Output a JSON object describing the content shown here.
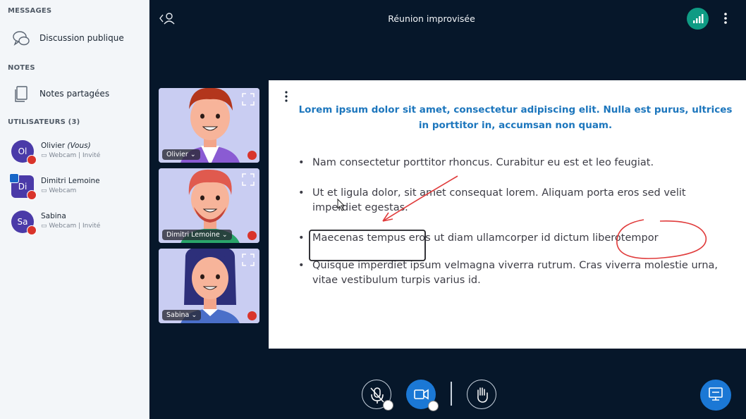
{
  "sidebar": {
    "messages_title": "MESSAGES",
    "public_chat": "Discussion publique",
    "notes_title": "NOTES",
    "shared_notes": "Notes partagées",
    "users_title": "UTILISATEURS (3)",
    "users": [
      {
        "initials": "Ol",
        "name": "Olivier",
        "you": "(Vous)",
        "sub": "Webcam | Invité"
      },
      {
        "initials": "Di",
        "name": "Dimitri Lemoine",
        "you": "",
        "sub": "Webcam"
      },
      {
        "initials": "Sa",
        "name": "Sabina",
        "you": "",
        "sub": "Webcam | Invité"
      }
    ]
  },
  "header": {
    "title": "Réunion improvisée"
  },
  "videos": [
    {
      "name": "Olivier"
    },
    {
      "name": "Dimitri Lemoine"
    },
    {
      "name": "Sabina"
    }
  ],
  "presentation": {
    "title": "Lorem ipsum dolor sit amet, consectetur adipiscing elit. Nulla est purus, ultrices in porttitor in, accumsan non quam.",
    "bullets": [
      "Nam consectetur porttitor rhoncus. Curabitur eu est et leo feugiat.",
      "Ut et ligula dolor, sit amet consequat lorem. Aliquam porta eros sed velit imperdiet egestas.",
      "Maecenas tempus eros ut diam ullamcorper id dictum liberotempor",
      "Quisque imperdiet ipsum velmagna viverra rutrum. Cras viverra molestie urna, vitae vestibulum turpis varius id."
    ]
  },
  "colors": {
    "sidebar_bg": "#f3f6f9",
    "app_bg": "#06172a",
    "accent": "#1b78d5",
    "slide_title": "#1c76bd",
    "connection": "#0f9b84",
    "mute_red": "#d9342b"
  },
  "icons": {
    "chat": "chat-bubbles-icon",
    "notes": "notes-icon",
    "mic": "microphone-muted-icon",
    "cam": "camera-icon",
    "hand": "raise-hand-icon",
    "present": "presentation-icon"
  }
}
